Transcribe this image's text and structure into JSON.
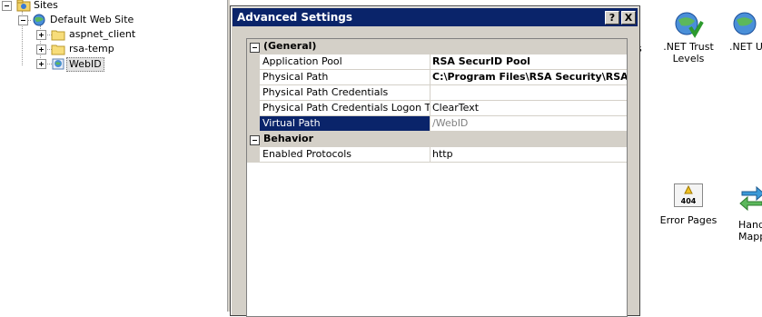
{
  "tree": {
    "sites_label": "Sites",
    "default_site_label": "Default Web Site",
    "children": [
      {
        "label": "aspnet_client"
      },
      {
        "label": "rsa-temp"
      },
      {
        "label": "WebID"
      }
    ]
  },
  "dialog": {
    "title": "Advanced Settings",
    "help_button": "?",
    "close_button": "X",
    "categories": [
      {
        "name": "(General)",
        "properties": [
          {
            "name": "Application Pool",
            "value": "RSA SecurID Pool"
          },
          {
            "name": "Physical Path",
            "value": "C:\\Program Files\\RSA Security\\RSAW"
          },
          {
            "name": "Physical Path Credentials",
            "value": ""
          },
          {
            "name": "Physical Path Credentials Logon Type",
            "value": "ClearText"
          },
          {
            "name": "Virtual Path",
            "value": "/WebID"
          }
        ]
      },
      {
        "name": "Behavior",
        "properties": [
          {
            "name": "Enabled Protocols",
            "value": "http"
          }
        ]
      }
    ]
  },
  "features": {
    "partial_left": "s",
    "net_trust_levels": ".NET Trust\nLevels",
    "net_u": ".NET U",
    "error_pages": "Error Pages",
    "error_badge": "404",
    "handler_mappings": "Hand\nMappi"
  },
  "colors": {
    "titlebar": "#0a246a",
    "selection": "#0a246a",
    "dialog_face": "#d4d0c8"
  }
}
